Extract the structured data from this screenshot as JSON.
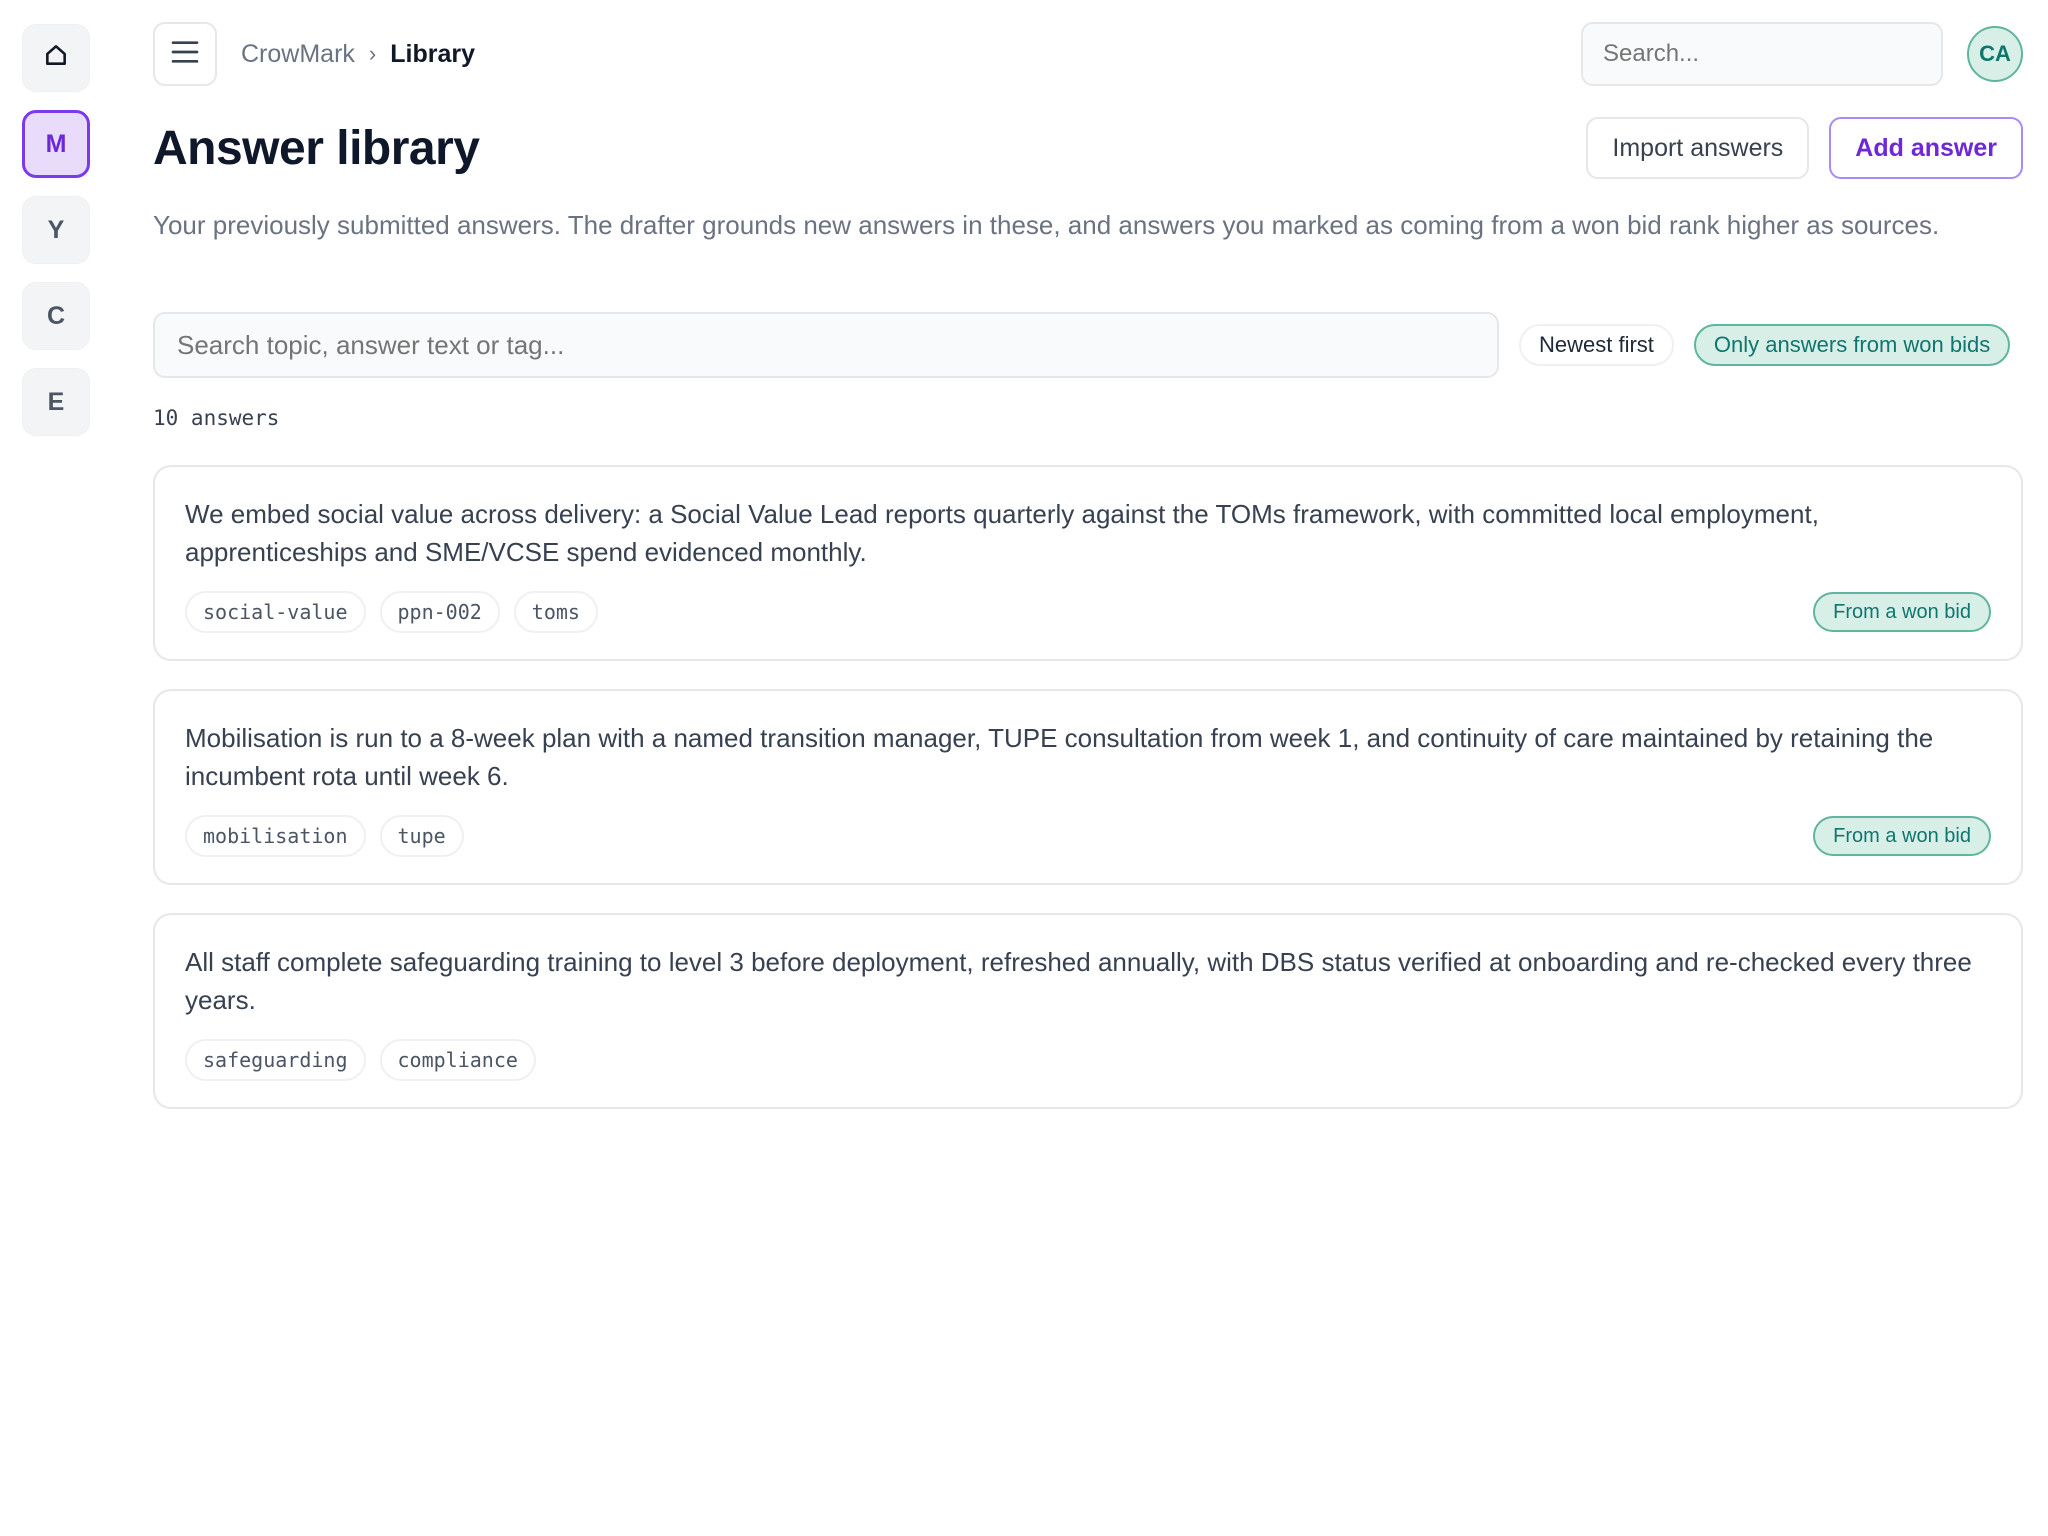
{
  "rail": {
    "items": [
      {
        "label": "",
        "icon": "home-icon"
      },
      {
        "label": "M",
        "active": true
      },
      {
        "label": "Y"
      },
      {
        "label": "C"
      },
      {
        "label": "E"
      }
    ]
  },
  "topbar": {
    "breadcrumb_root": "CrowMark",
    "breadcrumb_sep": "›",
    "breadcrumb_current": "Library",
    "search_placeholder": "Search...",
    "avatar_initials": "CA"
  },
  "header": {
    "title": "Answer library",
    "import_label": "Import answers",
    "add_label": "Add answer"
  },
  "description": "Your previously submitted answers. The drafter grounds new answers in these, and answers you marked as coming from a won bid rank higher as sources.",
  "filters": {
    "search_placeholder": "Search topic, answer text or tag...",
    "sort_label": "Newest first",
    "won_filter_label": "Only answers from won bids"
  },
  "count_label": "10 answers",
  "won_badge_label": "From a won bid",
  "answers": [
    {
      "text": "We embed social value across delivery: a Social Value Lead reports quarterly against the TOMs framework, with committed local employment, apprenticeships and SME/VCSE spend evidenced monthly.",
      "tags": [
        "social-value",
        "ppn-002",
        "toms"
      ],
      "won": true
    },
    {
      "text": "Mobilisation is run to a 8-week plan with a named transition manager, TUPE consultation from week 1, and continuity of care maintained by retaining the incumbent rota until week 6.",
      "tags": [
        "mobilisation",
        "tupe"
      ],
      "won": true
    },
    {
      "text": "All staff complete safeguarding training to level 3 before deployment, refreshed annually, with DBS status verified at onboarding and re-checked every three years.",
      "tags": [
        "safeguarding",
        "compliance"
      ],
      "won": false
    }
  ],
  "colors": {
    "accent": "#7c3aed",
    "won_green": "#0f766e"
  }
}
